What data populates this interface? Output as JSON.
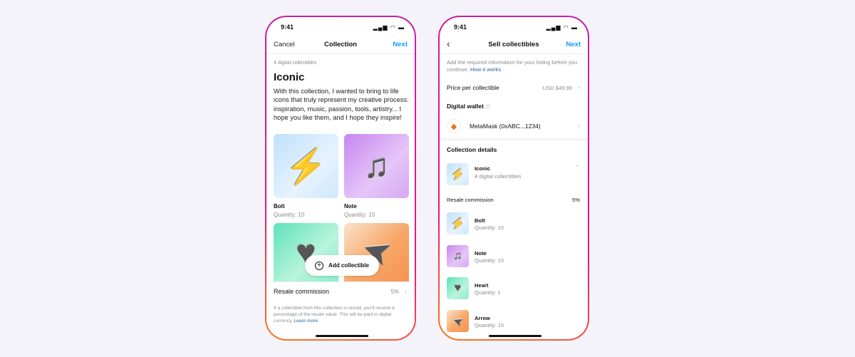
{
  "status": {
    "time": "9:41",
    "icons": [
      "signal-icon",
      "wifi-icon",
      "battery-icon"
    ]
  },
  "left": {
    "nav": {
      "cancel": "Cancel",
      "title": "Collection",
      "next": "Next"
    },
    "count": "4 digital collectibles",
    "title": "Iconic",
    "description": "With this collection, I wanted to bring to life icons that truly represent my creative process: inspiration, music, passion, tools, artistry... I hope you like them, and I hope they inspire!",
    "items": [
      {
        "name": "Bolt",
        "qty": "Quantity: 10",
        "icon": "bolt-icon"
      },
      {
        "name": "Note",
        "qty": "Quantity: 10",
        "icon": "music-note-icon"
      },
      {
        "icon": "heart-icon"
      },
      {
        "icon": "arrow-icon"
      }
    ],
    "add_button": "Add collectible",
    "resale": {
      "label": "Resale commission",
      "value": "5%"
    },
    "footer": "If a collectible from this collection is resold, you'll receive a percentage of the resale value. This will be paid in digital currency.",
    "learn_more": "Learn more"
  },
  "right": {
    "nav": {
      "title": "Sell collectibles",
      "next": "Next"
    },
    "info": "Add the required information for your listing before you continue.",
    "how_it_works": "How it works",
    "price": {
      "label": "Price per collectible",
      "value": "USD $49.99"
    },
    "wallet": {
      "heading": "Digital wallet",
      "name": "MetaMask (0xABC...1234)"
    },
    "details_heading": "Collection details",
    "collection": {
      "name": "Iconic",
      "sub": "4 digital collectibles"
    },
    "resale": {
      "label": "Resale commission",
      "value": "5%"
    },
    "items": [
      {
        "name": "Bolt",
        "qty": "Quantity: 10"
      },
      {
        "name": "Note",
        "qty": "Quantity: 10"
      },
      {
        "name": "Heart",
        "qty": "Quantity: 1"
      },
      {
        "name": "Arrow",
        "qty": "Quantity: 10"
      }
    ]
  },
  "colors": {
    "accent": "#1a9af0",
    "link": "#1d5e9e",
    "frame_gradient": [
      "#f77b1c",
      "#e8177a",
      "#c21fb0"
    ]
  }
}
